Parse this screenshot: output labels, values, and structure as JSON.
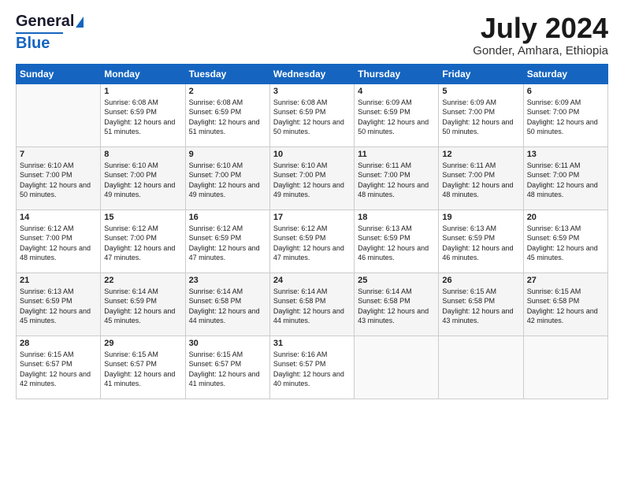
{
  "logo": {
    "line1": "General",
    "line2": "Blue"
  },
  "header": {
    "title": "July 2024",
    "location": "Gonder, Amhara, Ethiopia"
  },
  "days_of_week": [
    "Sunday",
    "Monday",
    "Tuesday",
    "Wednesday",
    "Thursday",
    "Friday",
    "Saturday"
  ],
  "weeks": [
    [
      {
        "day": "",
        "sunrise": "",
        "sunset": "",
        "daylight": ""
      },
      {
        "day": "1",
        "sunrise": "Sunrise: 6:08 AM",
        "sunset": "Sunset: 6:59 PM",
        "daylight": "Daylight: 12 hours and 51 minutes."
      },
      {
        "day": "2",
        "sunrise": "Sunrise: 6:08 AM",
        "sunset": "Sunset: 6:59 PM",
        "daylight": "Daylight: 12 hours and 51 minutes."
      },
      {
        "day": "3",
        "sunrise": "Sunrise: 6:08 AM",
        "sunset": "Sunset: 6:59 PM",
        "daylight": "Daylight: 12 hours and 50 minutes."
      },
      {
        "day": "4",
        "sunrise": "Sunrise: 6:09 AM",
        "sunset": "Sunset: 6:59 PM",
        "daylight": "Daylight: 12 hours and 50 minutes."
      },
      {
        "day": "5",
        "sunrise": "Sunrise: 6:09 AM",
        "sunset": "Sunset: 7:00 PM",
        "daylight": "Daylight: 12 hours and 50 minutes."
      },
      {
        "day": "6",
        "sunrise": "Sunrise: 6:09 AM",
        "sunset": "Sunset: 7:00 PM",
        "daylight": "Daylight: 12 hours and 50 minutes."
      }
    ],
    [
      {
        "day": "7",
        "sunrise": "Sunrise: 6:10 AM",
        "sunset": "Sunset: 7:00 PM",
        "daylight": "Daylight: 12 hours and 50 minutes."
      },
      {
        "day": "8",
        "sunrise": "Sunrise: 6:10 AM",
        "sunset": "Sunset: 7:00 PM",
        "daylight": "Daylight: 12 hours and 49 minutes."
      },
      {
        "day": "9",
        "sunrise": "Sunrise: 6:10 AM",
        "sunset": "Sunset: 7:00 PM",
        "daylight": "Daylight: 12 hours and 49 minutes."
      },
      {
        "day": "10",
        "sunrise": "Sunrise: 6:10 AM",
        "sunset": "Sunset: 7:00 PM",
        "daylight": "Daylight: 12 hours and 49 minutes."
      },
      {
        "day": "11",
        "sunrise": "Sunrise: 6:11 AM",
        "sunset": "Sunset: 7:00 PM",
        "daylight": "Daylight: 12 hours and 48 minutes."
      },
      {
        "day": "12",
        "sunrise": "Sunrise: 6:11 AM",
        "sunset": "Sunset: 7:00 PM",
        "daylight": "Daylight: 12 hours and 48 minutes."
      },
      {
        "day": "13",
        "sunrise": "Sunrise: 6:11 AM",
        "sunset": "Sunset: 7:00 PM",
        "daylight": "Daylight: 12 hours and 48 minutes."
      }
    ],
    [
      {
        "day": "14",
        "sunrise": "Sunrise: 6:12 AM",
        "sunset": "Sunset: 7:00 PM",
        "daylight": "Daylight: 12 hours and 48 minutes."
      },
      {
        "day": "15",
        "sunrise": "Sunrise: 6:12 AM",
        "sunset": "Sunset: 7:00 PM",
        "daylight": "Daylight: 12 hours and 47 minutes."
      },
      {
        "day": "16",
        "sunrise": "Sunrise: 6:12 AM",
        "sunset": "Sunset: 6:59 PM",
        "daylight": "Daylight: 12 hours and 47 minutes."
      },
      {
        "day": "17",
        "sunrise": "Sunrise: 6:12 AM",
        "sunset": "Sunset: 6:59 PM",
        "daylight": "Daylight: 12 hours and 47 minutes."
      },
      {
        "day": "18",
        "sunrise": "Sunrise: 6:13 AM",
        "sunset": "Sunset: 6:59 PM",
        "daylight": "Daylight: 12 hours and 46 minutes."
      },
      {
        "day": "19",
        "sunrise": "Sunrise: 6:13 AM",
        "sunset": "Sunset: 6:59 PM",
        "daylight": "Daylight: 12 hours and 46 minutes."
      },
      {
        "day": "20",
        "sunrise": "Sunrise: 6:13 AM",
        "sunset": "Sunset: 6:59 PM",
        "daylight": "Daylight: 12 hours and 45 minutes."
      }
    ],
    [
      {
        "day": "21",
        "sunrise": "Sunrise: 6:13 AM",
        "sunset": "Sunset: 6:59 PM",
        "daylight": "Daylight: 12 hours and 45 minutes."
      },
      {
        "day": "22",
        "sunrise": "Sunrise: 6:14 AM",
        "sunset": "Sunset: 6:59 PM",
        "daylight": "Daylight: 12 hours and 45 minutes."
      },
      {
        "day": "23",
        "sunrise": "Sunrise: 6:14 AM",
        "sunset": "Sunset: 6:58 PM",
        "daylight": "Daylight: 12 hours and 44 minutes."
      },
      {
        "day": "24",
        "sunrise": "Sunrise: 6:14 AM",
        "sunset": "Sunset: 6:58 PM",
        "daylight": "Daylight: 12 hours and 44 minutes."
      },
      {
        "day": "25",
        "sunrise": "Sunrise: 6:14 AM",
        "sunset": "Sunset: 6:58 PM",
        "daylight": "Daylight: 12 hours and 43 minutes."
      },
      {
        "day": "26",
        "sunrise": "Sunrise: 6:15 AM",
        "sunset": "Sunset: 6:58 PM",
        "daylight": "Daylight: 12 hours and 43 minutes."
      },
      {
        "day": "27",
        "sunrise": "Sunrise: 6:15 AM",
        "sunset": "Sunset: 6:58 PM",
        "daylight": "Daylight: 12 hours and 42 minutes."
      }
    ],
    [
      {
        "day": "28",
        "sunrise": "Sunrise: 6:15 AM",
        "sunset": "Sunset: 6:57 PM",
        "daylight": "Daylight: 12 hours and 42 minutes."
      },
      {
        "day": "29",
        "sunrise": "Sunrise: 6:15 AM",
        "sunset": "Sunset: 6:57 PM",
        "daylight": "Daylight: 12 hours and 41 minutes."
      },
      {
        "day": "30",
        "sunrise": "Sunrise: 6:15 AM",
        "sunset": "Sunset: 6:57 PM",
        "daylight": "Daylight: 12 hours and 41 minutes."
      },
      {
        "day": "31",
        "sunrise": "Sunrise: 6:16 AM",
        "sunset": "Sunset: 6:57 PM",
        "daylight": "Daylight: 12 hours and 40 minutes."
      },
      {
        "day": "",
        "sunrise": "",
        "sunset": "",
        "daylight": ""
      },
      {
        "day": "",
        "sunrise": "",
        "sunset": "",
        "daylight": ""
      },
      {
        "day": "",
        "sunrise": "",
        "sunset": "",
        "daylight": ""
      }
    ]
  ]
}
